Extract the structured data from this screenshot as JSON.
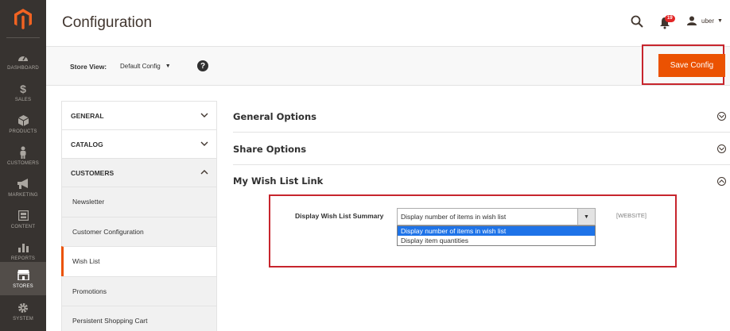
{
  "sidebar": {
    "items": [
      {
        "label": "DASHBOARD",
        "icon": "dashboard-icon"
      },
      {
        "label": "SALES",
        "icon": "dollar-icon"
      },
      {
        "label": "PRODUCTS",
        "icon": "box-icon"
      },
      {
        "label": "CUSTOMERS",
        "icon": "person-icon"
      },
      {
        "label": "MARKETING",
        "icon": "megaphone-icon"
      },
      {
        "label": "CONTENT",
        "icon": "content-icon"
      },
      {
        "label": "REPORTS",
        "icon": "bar-chart-icon"
      },
      {
        "label": "STORES",
        "icon": "store-icon"
      },
      {
        "label": "SYSTEM",
        "icon": "gear-icon"
      }
    ],
    "active": "STORES"
  },
  "header": {
    "title": "Configuration",
    "notifications_count": "19",
    "user_name": "uber"
  },
  "store_bar": {
    "label": "Store View:",
    "selected": "Default Config",
    "help": "?",
    "save_label": "Save Config"
  },
  "tabs": [
    {
      "label": "GENERAL"
    },
    {
      "label": "CATALOG"
    },
    {
      "label": "CUSTOMERS"
    }
  ],
  "customer_items": [
    {
      "label": "Newsletter"
    },
    {
      "label": "Customer Configuration"
    },
    {
      "label": "Wish List"
    },
    {
      "label": "Promotions"
    },
    {
      "label": "Persistent Shopping Cart"
    }
  ],
  "sections": [
    {
      "title": "General Options"
    },
    {
      "title": "Share Options"
    },
    {
      "title": "My Wish List Link"
    }
  ],
  "wishlist_field": {
    "label": "Display Wish List Summary",
    "value": "Display number of items in wish list",
    "scope": "[WEBSITE]",
    "options": [
      "Display number of items in wish list",
      "Display item quantities"
    ]
  },
  "colors": {
    "accent": "#eb5202",
    "sidebar_bg": "#373330",
    "highlight_frame": "#c7252d",
    "selected_option": "#1e73e8"
  }
}
